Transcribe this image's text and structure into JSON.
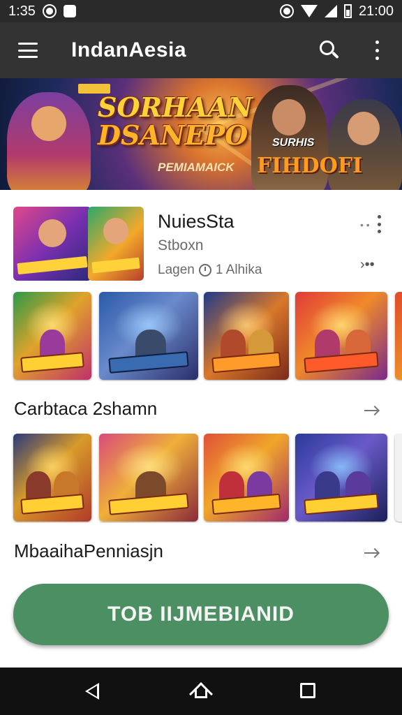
{
  "status_bar": {
    "time_left": "1:35",
    "time_right": "21:00"
  },
  "app_bar": {
    "title": "IndanAesia"
  },
  "banner": {
    "title_line1": "SORHAAN",
    "title_line2": "DSANEPO",
    "subtitle": "PEMIAMAICK",
    "tag_small": "SURHIS",
    "tag_large": "FIHDOFI"
  },
  "featured": {
    "title": "NuiesSta",
    "subtitle": "Stboxn",
    "meta_label": "Lagen",
    "meta_value": "1 Alhika"
  },
  "sections": [
    {
      "title": "Carbtaca 2shamn"
    },
    {
      "title": "MbaaihaPenniasjn"
    }
  ],
  "cta": {
    "label": "TOB IIJMEBIANID"
  },
  "colors": {
    "app_bar": "#333333",
    "cta": "#4b8f63",
    "status_bar": "#2a2a2a",
    "nav_bar": "#111111"
  },
  "icons": [
    "menu-icon",
    "search-icon",
    "more-vert-icon",
    "arrow-right-icon",
    "clock-icon",
    "nav-back-icon",
    "nav-home-icon",
    "nav-recents-icon"
  ]
}
